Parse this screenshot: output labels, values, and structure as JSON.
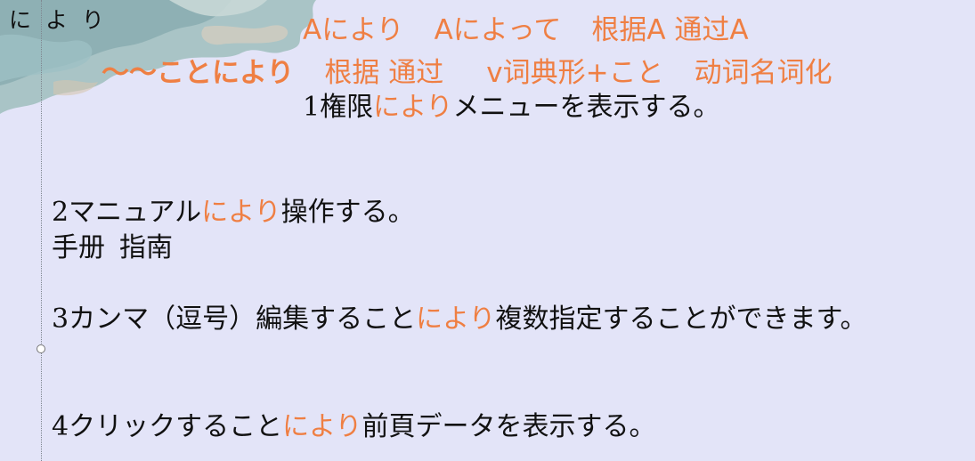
{
  "title": "に よ り",
  "header": {
    "row1": {
      "p1": "Aにより",
      "p2": "Aによって",
      "p3": "根据A 通过A"
    },
    "row2": {
      "p1": "～～ことにより",
      "p2": "根据 通过",
      "p3": "v词典形+こと",
      "p4": "动词名词化"
    }
  },
  "sentences": [
    {
      "before": "1権限",
      "highlight": "により",
      "after": "メニューを表示する。"
    },
    {
      "before": "2マニュアル",
      "highlight": "により",
      "after": "操作する。"
    },
    {
      "before": "3カンマ（逗号）編集すること",
      "highlight": "により",
      "after": "複数指定することができます。"
    },
    {
      "before": "4クリックすること",
      "highlight": "により",
      "after": "前頁データを表示する。"
    }
  ],
  "note": {
    "w1": "手册",
    "w2": "指南"
  },
  "colors": {
    "background": "#e3e4f8",
    "accent": "#ef7f43",
    "text": "#111111"
  }
}
